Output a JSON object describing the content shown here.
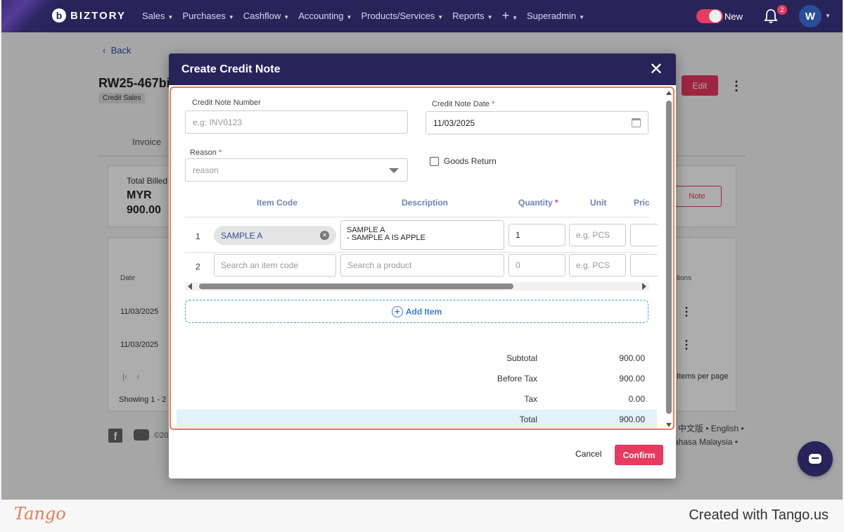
{
  "nav": {
    "brand": "BIZTORY",
    "menu": [
      "Sales",
      "Purchases",
      "Cashflow",
      "Accounting",
      "Products/Services",
      "Reports",
      "+",
      "Superadmin"
    ],
    "new_label": "New",
    "notifications": "2",
    "avatar": "W"
  },
  "background": {
    "back": "Back",
    "doc_title": "RW25-467bi",
    "tag": "Credit Sales",
    "edit": "Edit",
    "tab_invoice": "Invoice",
    "total_billed_label": "Total Billed",
    "total_billed_currency": "MYR",
    "total_billed_value": "900.00",
    "note_btn": "Note",
    "col_date": "Date",
    "col_actions": "tions",
    "rows": [
      "11/03/2025",
      "11/03/2025"
    ],
    "items_per_page": "Items per page",
    "showing": "Showing 1 - 2 c",
    "copyright": "©20",
    "lang_line1": "中文版 • English •",
    "lang_line2": "ahasa Malaysia •"
  },
  "modal": {
    "title": "Create Credit Note",
    "credit_note_number_label": "Credit Note Number",
    "credit_note_number_placeholder": "e.g: INV0123",
    "credit_note_date_label": "Credit Note Date",
    "credit_note_date_value": "11/03/2025",
    "reason_label": "Reason",
    "reason_placeholder": "reason",
    "goods_return_label": "Goods Return",
    "required_mark": "*",
    "columns": {
      "item_code": "Item Code",
      "description": "Description",
      "quantity": "Quantity",
      "unit": "Unit",
      "price": "Pric"
    },
    "rows": [
      {
        "num": "1",
        "item_code": "SAMPLE A",
        "description_line1": "SAMPLE A",
        "description_line2": "- SAMPLE A IS APPLE",
        "quantity": "1",
        "unit_placeholder": "e.g. PCS"
      },
      {
        "num": "2",
        "item_code_placeholder": "Search an item code",
        "description_placeholder": "Search a product",
        "quantity_placeholder": "0",
        "unit_placeholder": "e.g. PCS"
      }
    ],
    "add_item": "Add Item",
    "summary": [
      {
        "label": "Subtotal",
        "value": "900.00"
      },
      {
        "label": "Before Tax",
        "value": "900.00"
      },
      {
        "label": "Tax",
        "value": "0.00"
      },
      {
        "label": "Total",
        "value": "900.00"
      }
    ],
    "cancel": "Cancel",
    "confirm": "Confirm"
  },
  "footer": {
    "brand": "Tango",
    "credit": "Created with Tango.us"
  },
  "colors": {
    "nav_bg": "#27245a",
    "accent": "#e8395f",
    "highlight_border": "#ee7a4f",
    "link": "#2d4f9c"
  }
}
